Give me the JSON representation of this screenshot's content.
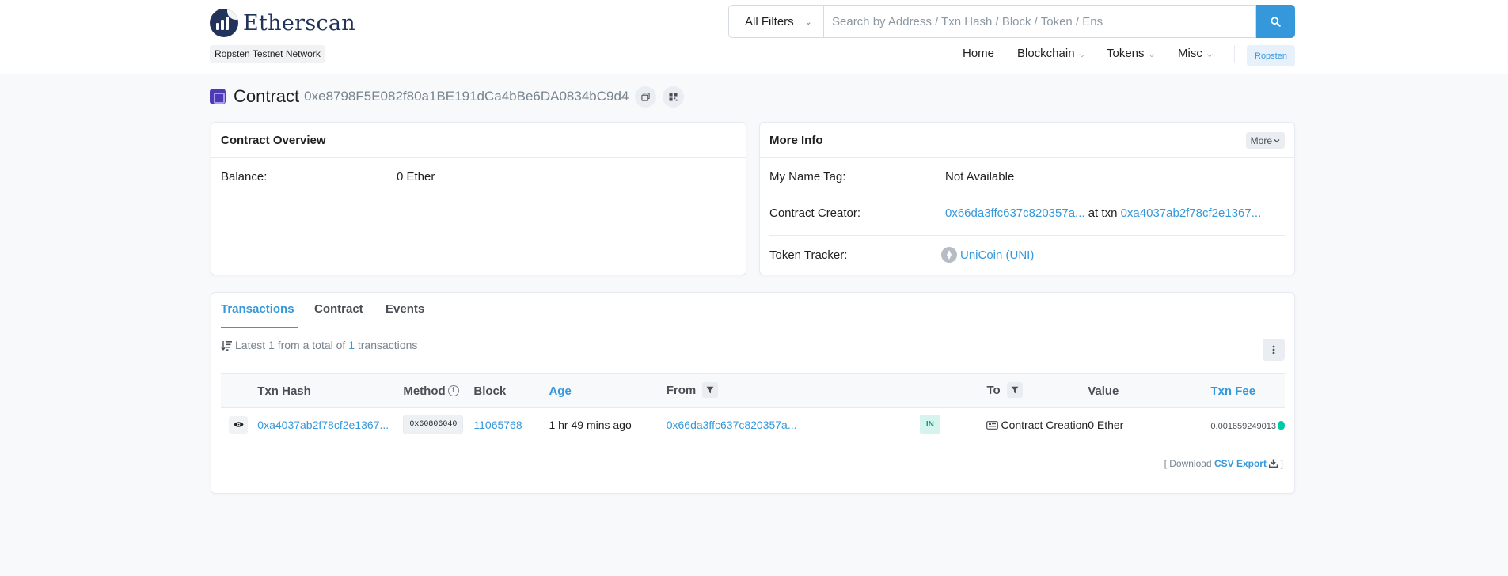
{
  "header": {
    "logo_text": "Etherscan",
    "network_label": "Ropsten Testnet Network",
    "search": {
      "filter_label": "All Filters",
      "placeholder": "Search by Address / Txn Hash / Block / Token / Ens"
    },
    "nav": {
      "home": "Home",
      "blockchain": "Blockchain",
      "tokens": "Tokens",
      "misc": "Misc",
      "network_button": "Ropsten"
    }
  },
  "title": {
    "label": "Contract",
    "address": "0xe8798F5E082f80a1BE191dCa4bBe6DA0834bC9d4"
  },
  "overview": {
    "header": "Contract Overview",
    "balance_label": "Balance:",
    "balance_value": "0 Ether"
  },
  "more_info": {
    "header": "More Info",
    "more_button": "More",
    "name_tag_label": "My Name Tag:",
    "name_tag_value": "Not Available",
    "creator_label": "Contract Creator:",
    "creator_address": "0x66da3ffc637c820357a...",
    "creator_at_txn": "at txn",
    "creator_txn": "0xa4037ab2f78cf2e1367...",
    "token_tracker_label": "Token Tracker:",
    "token_tracker_value": "UniCoin (UNI)"
  },
  "tabs": {
    "transactions": "Transactions",
    "contract": "Contract",
    "events": "Events"
  },
  "summary": {
    "prefix": "Latest 1 from a total of",
    "count": "1",
    "suffix": "transactions"
  },
  "table": {
    "headers": {
      "txn_hash": "Txn Hash",
      "method": "Method",
      "block": "Block",
      "age": "Age",
      "from": "From",
      "to": "To",
      "value": "Value",
      "txn_fee": "Txn Fee"
    },
    "rows": [
      {
        "txn_hash": "0xa4037ab2f78cf2e1367...",
        "method": "0x60806040",
        "block": "11065768",
        "age": "1 hr 49 mins ago",
        "from": "0x66da3ffc637c820357a...",
        "direction": "IN",
        "to": "Contract Creation",
        "value": "0 Ether",
        "txn_fee": "0.001659249013"
      }
    ]
  },
  "download": {
    "prefix": "[ Download",
    "link": "CSV Export",
    "suffix": "]"
  },
  "colors": {
    "accent": "#3498db",
    "in_badge_bg": "#d7f3ed",
    "in_badge_text": "#00a186",
    "page_bg": "#f8f9fa"
  }
}
